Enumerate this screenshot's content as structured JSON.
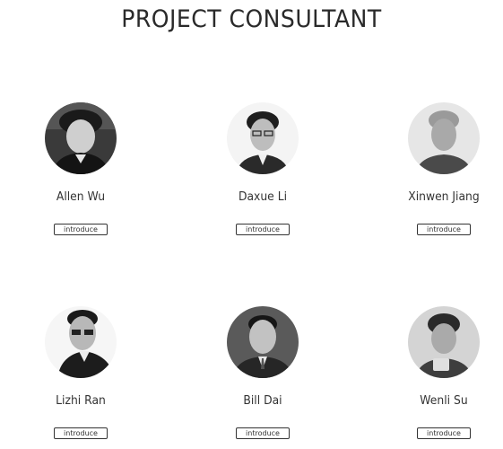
{
  "page": {
    "title": "PROJECT CONSULTANT"
  },
  "consultants": [
    {
      "name": "Allen Wu",
      "button_label": "introduce"
    },
    {
      "name": "Daxue Li",
      "button_label": "introduce"
    },
    {
      "name": "Xinwen Jiang",
      "button_label": "introduce"
    },
    {
      "name": "Lizhi Ran",
      "button_label": "introduce"
    },
    {
      "name": "Bill Dai",
      "button_label": "introduce"
    },
    {
      "name": "Wenli Su",
      "button_label": "introduce"
    }
  ]
}
